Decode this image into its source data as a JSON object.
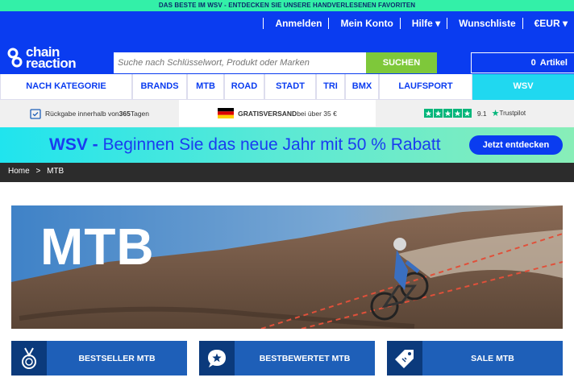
{
  "top_bar": {
    "text": "DAS BESTE IM WSV - ENTDECKEN SIE UNSERE HANDVERLESENEN FAVORITEN"
  },
  "header": {
    "account_links": [
      {
        "label": "Anmelden"
      },
      {
        "label": "Mein Konto"
      },
      {
        "label": "Hilfe ▾"
      },
      {
        "label": "Wunschliste"
      },
      {
        "label": "€EUR ▾"
      }
    ],
    "logo": {
      "line1": "chain",
      "line2": "reaction"
    },
    "search": {
      "placeholder": "Suche nach Schlüsselwort, Produkt oder Marken",
      "button_label": "SUCHEN"
    },
    "cart": {
      "count": "0",
      "label": "Artikel"
    }
  },
  "nav": {
    "items": [
      {
        "label": "NACH KATEGORIE EINKAUFEN"
      },
      {
        "label": "BRANDS"
      },
      {
        "label": "MTB"
      },
      {
        "label": "ROAD"
      },
      {
        "label": "STADT"
      },
      {
        "label": "TRI"
      },
      {
        "label": "BMX"
      },
      {
        "label": "LAUFSPORT"
      },
      {
        "label": "WSV"
      }
    ]
  },
  "trust": {
    "returns_prefix": "Rückgabe innerhalb von ",
    "returns_days": "365",
    "returns_suffix": "Tagen",
    "shipping_bold": "GRATISVERSAND",
    "shipping_rest": " bei über 35 €",
    "rating": "9.1",
    "trustpilot": "Trustpilot"
  },
  "promo": {
    "title_bold": "WSV -",
    "title_rest": " Beginnen Sie das neue Jahr mit 50 % Rabatt",
    "button": "Jetzt entdecken"
  },
  "breadcrumb": {
    "home": "Home",
    "separator": ">",
    "current": "MTB"
  },
  "hero": {
    "title": "MTB"
  },
  "categories": [
    {
      "label": "BESTSELLER MTB",
      "icon": "medal-icon"
    },
    {
      "label": "BESTBEWERTET MTB",
      "icon": "star-bubble-icon"
    },
    {
      "label": "SALE MTB",
      "icon": "price-tag-icon"
    }
  ],
  "colors": {
    "brand_blue": "#0a3cf0",
    "accent_green": "#7ec83a",
    "wsv_cyan": "#20d8f0",
    "trustpilot_green": "#00b67a"
  }
}
